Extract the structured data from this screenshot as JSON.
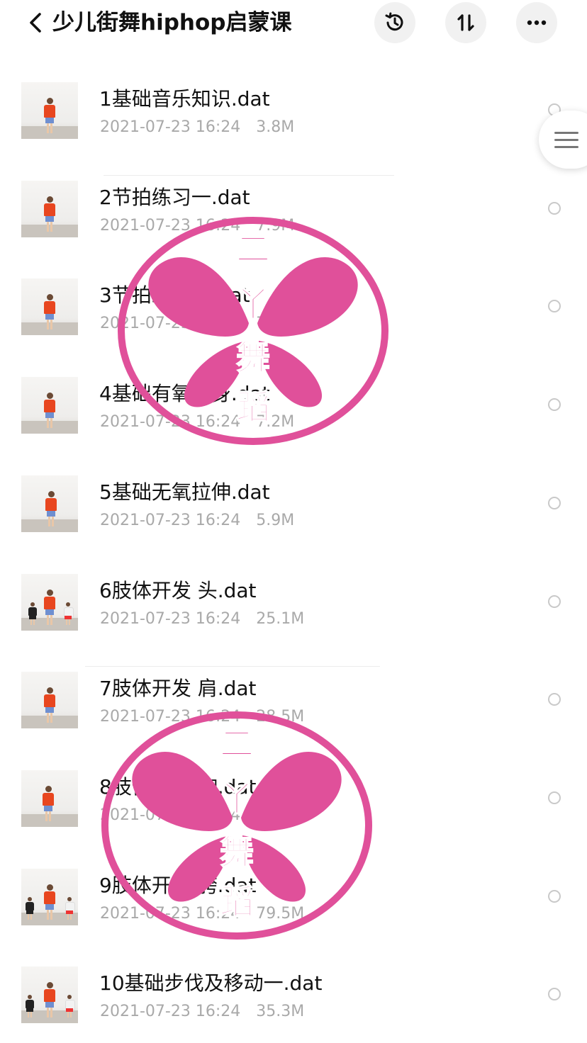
{
  "header": {
    "title": "少儿街舞hiphop启蒙课",
    "back_icon": "chevron-left-icon",
    "history_icon": "history-clock-icon",
    "sort_icon": "sort-arrows-icon",
    "more_icon": "more-dots-icon"
  },
  "files": [
    {
      "name": "1基础音乐知识.dat",
      "date": "2021-07-23 16:24",
      "size": "3.8M"
    },
    {
      "name": "2节拍练习一.dat",
      "date": "2021-07-23 16:24",
      "size": "7.9M"
    },
    {
      "name": "3节拍练习二.dat",
      "date": "2021-07-23 16:24",
      "size": "7.5M"
    },
    {
      "name": "4基础有氧热身.dat",
      "date": "2021-07-23 16:24",
      "size": "7.2M"
    },
    {
      "name": "5基础无氧拉伸.dat",
      "date": "2021-07-23 16:24",
      "size": "5.9M"
    },
    {
      "name": "6肢体开发 头.dat",
      "date": "2021-07-23 16:24",
      "size": "25.1M"
    },
    {
      "name": "7肢体开发 肩.dat",
      "date": "2021-07-23 16:24",
      "size": "28.5M"
    },
    {
      "name": "8肢体开发 胸.dat",
      "date": "2021-07-23 16:24",
      "size": "21.8M"
    },
    {
      "name": "9肢体开发 胯.dat",
      "date": "2021-07-23 16:24",
      "size": "79.5M"
    },
    {
      "name": "10基础步伐及移动一.dat",
      "date": "2021-07-23 16:24",
      "size": "35.3M"
    }
  ],
  "watermark": {
    "chars": [
      "二",
      "丫",
      "舞",
      "蹈"
    ],
    "color": "#e0509a"
  },
  "side_menu_icon": "menu-lines-icon"
}
